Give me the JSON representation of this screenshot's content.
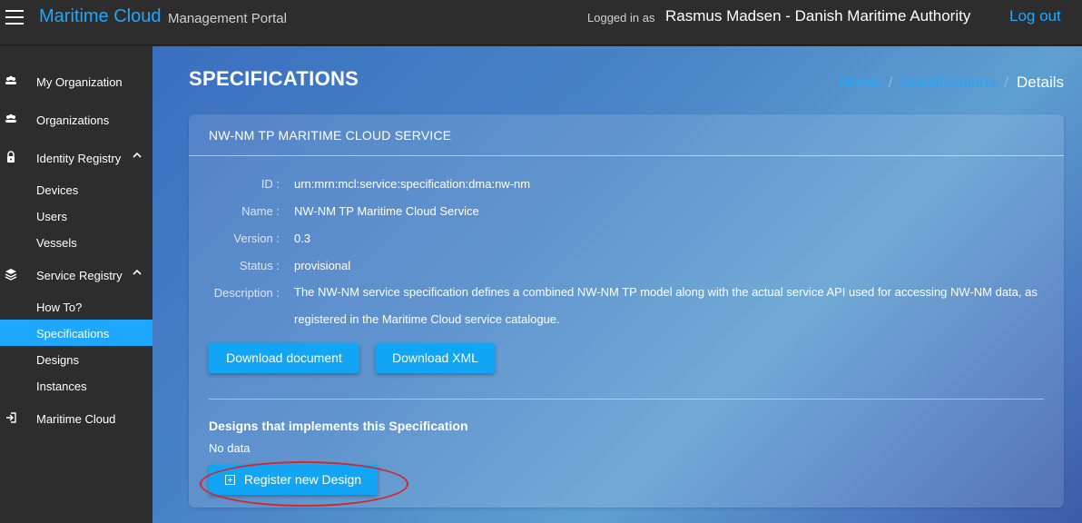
{
  "topbar": {
    "brand": "Maritime Cloud",
    "brand_sub": "Management Portal",
    "logged_in_prefix": "Logged in as",
    "user": "Rasmus Madsen - Danish Maritime Authority",
    "logout": "Log out"
  },
  "sidebar": {
    "items": [
      {
        "label": "My Organization",
        "icon": "group-icon"
      },
      {
        "label": "Organizations",
        "icon": "group-icon"
      },
      {
        "label": "Identity Registry",
        "icon": "lock-icon",
        "expanded": true
      },
      {
        "label": "Devices"
      },
      {
        "label": "Users"
      },
      {
        "label": "Vessels"
      },
      {
        "label": "Service Registry",
        "icon": "layers-icon",
        "expanded": true
      },
      {
        "label": "How To?"
      },
      {
        "label": "Specifications",
        "active": true
      },
      {
        "label": "Designs"
      },
      {
        "label": "Instances"
      },
      {
        "label": "Maritime Cloud",
        "icon": "sign-in-icon"
      }
    ],
    "active_color": "#1ea7ff"
  },
  "main": {
    "page_title": "SPECIFICATIONS",
    "breadcrumb": [
      "Home",
      "Specifications",
      "Details"
    ],
    "card": {
      "title": "NW-NM TP MARITIME CLOUD SERVICE",
      "fields": {
        "id_label": "ID :",
        "id_value": "urn:mrn:mcl:service:specification:dma:nw-nm",
        "name_label": "Name :",
        "name_value": "NW-NM TP Maritime Cloud Service",
        "version_label": "Version :",
        "version_value": "0.3",
        "status_label": "Status :",
        "status_value": "provisional",
        "description_label": "Description :",
        "description_value": "The NW-NM service specification defines a combined NW-NM TP model along with the actual service API used for accessing NW-NM data, as registered in the Maritime Cloud service catalogue."
      },
      "download_document": "Download document",
      "download_xml": "Download XML",
      "designs_title": "Designs that implements this Specification",
      "no_data": "No data",
      "register_button": "Register new Design"
    }
  },
  "colors": {
    "accent": "#1ea7ff",
    "button": "#12a5f4",
    "topbar": "#2d2d2d",
    "annotation": "#d4262b"
  }
}
